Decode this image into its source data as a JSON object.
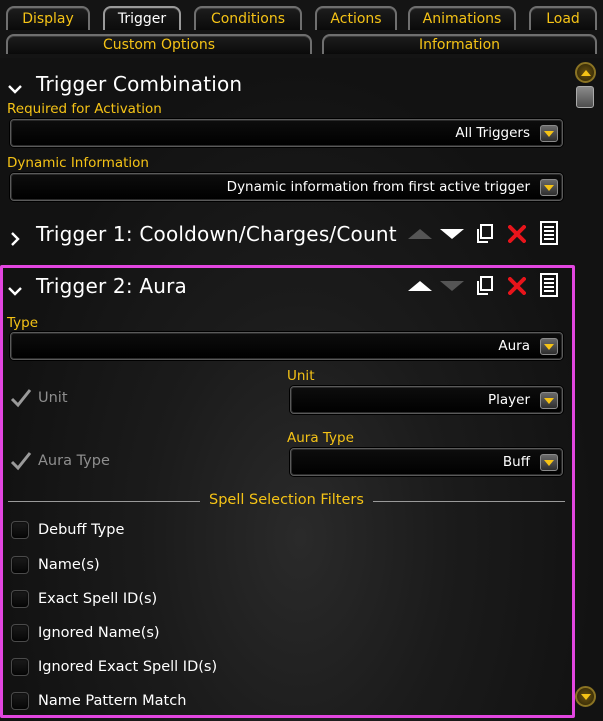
{
  "tabs_row1": [
    {
      "label": "Display"
    },
    {
      "label": "Trigger",
      "active": true
    },
    {
      "label": "Conditions"
    },
    {
      "label": "Actions"
    },
    {
      "label": "Animations"
    },
    {
      "label": "Load"
    }
  ],
  "tabs_row2": [
    {
      "label": "Custom Options"
    },
    {
      "label": "Information"
    }
  ],
  "trigger_combination": {
    "title": "Trigger Combination",
    "required_label": "Required for Activation",
    "required_value": "All Triggers",
    "dynamic_label": "Dynamic Information",
    "dynamic_value": "Dynamic information from first active trigger"
  },
  "trigger1": {
    "title": "Trigger 1: Cooldown/Charges/Count"
  },
  "trigger2": {
    "title": "Trigger 2: Aura",
    "type_label": "Type",
    "type_value": "Aura",
    "unit_check_label": "Unit",
    "unit_label": "Unit",
    "unit_value": "Player",
    "aura_type_check_label": "Aura Type",
    "aura_type_label": "Aura Type",
    "aura_type_value": "Buff",
    "filters_heading": "Spell Selection Filters",
    "filters": [
      {
        "label": "Debuff Type"
      },
      {
        "label": "Name(s)"
      },
      {
        "label": "Exact Spell ID(s)"
      },
      {
        "label": "Ignored Name(s)"
      },
      {
        "label": "Ignored Exact Spell ID(s)"
      },
      {
        "label": "Name Pattern Match"
      }
    ]
  },
  "colors": {
    "accent_gold": "#f5c316",
    "highlight_border": "#e246e0",
    "delete_red": "#e8141b"
  }
}
